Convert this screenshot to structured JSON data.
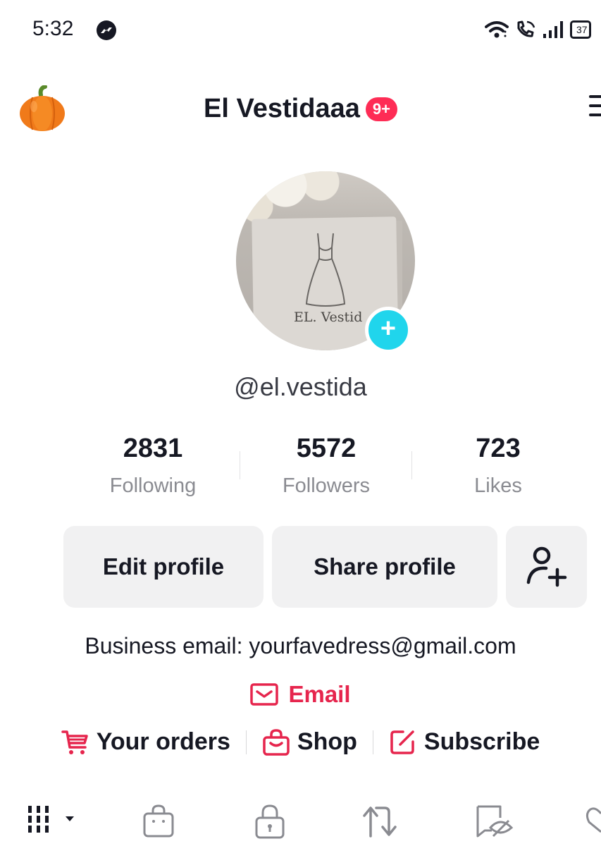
{
  "status_bar": {
    "time": "5:32",
    "battery": "37"
  },
  "header": {
    "title": "El Vestidaaa",
    "badge": "9+"
  },
  "profile": {
    "avatar_text": "EL. Vestid",
    "username": "@el.vestida",
    "stats": [
      {
        "value": "2831",
        "label": "Following"
      },
      {
        "value": "5572",
        "label": "Followers"
      },
      {
        "value": "723",
        "label": "Likes"
      }
    ]
  },
  "actions": {
    "edit_label": "Edit profile",
    "share_label": "Share profile"
  },
  "bio": {
    "text": "Business email: yourfavedress@gmail.com",
    "email_link": "Email"
  },
  "links": [
    {
      "label": "Your orders",
      "icon": "cart-icon"
    },
    {
      "label": "Shop",
      "icon": "shop-bag-icon"
    },
    {
      "label": "Subscribe",
      "icon": "edit-icon"
    }
  ],
  "tabs": [
    {
      "icon": "grid-icon"
    },
    {
      "icon": "shop-bag-icon"
    },
    {
      "icon": "lock-icon"
    },
    {
      "icon": "repost-icon"
    },
    {
      "icon": "hidden-icon"
    },
    {
      "icon": "heart-icon"
    }
  ],
  "colors": {
    "accent": "#fe2c55",
    "link_red": "#e6254d",
    "avatar_plus": "#20d5ec",
    "button_bg": "#f1f1f2",
    "muted_text": "#8a8b91"
  }
}
